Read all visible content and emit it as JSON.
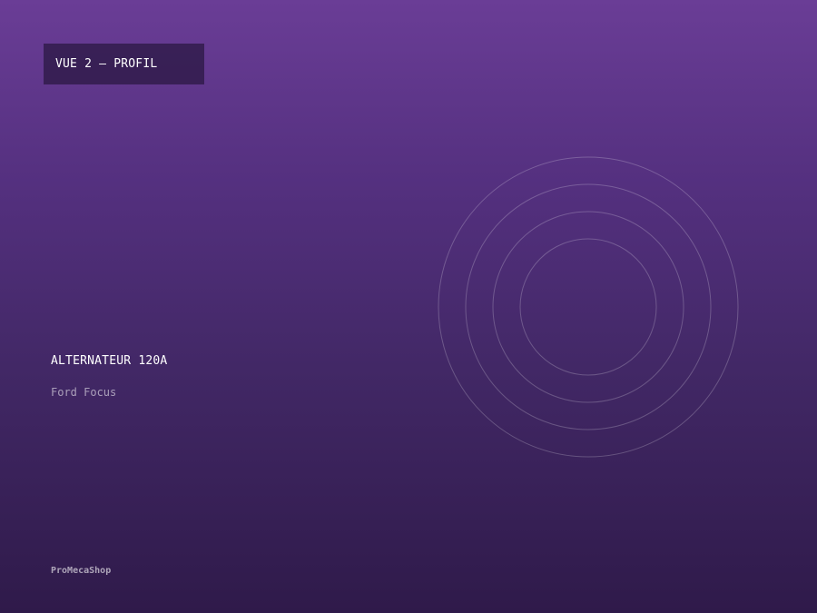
{
  "view_label": "VUE 2 — PROFIL",
  "product": {
    "name": "ALTERNATEUR 120A",
    "model": "Ford Focus"
  },
  "brand": "ProMecaShop",
  "graphic": {
    "icon": "concentric-rings-icon",
    "ring_color": "#ffffff"
  }
}
